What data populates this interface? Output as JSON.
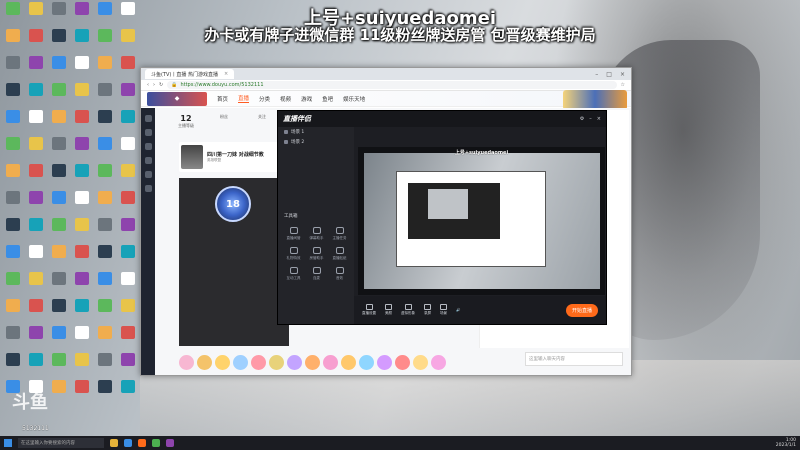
{
  "overlay": {
    "line1": "上号+suiyuedaomei",
    "line2": "办卡或有牌子进微信群 11级粉丝牌送房管  包晋级赛维护局"
  },
  "browser": {
    "tab_title": "斗鱼(TV)丨直播 热门游戏直播",
    "url": "https://www.douyu.com/5132111",
    "nav": [
      "首页",
      "直播",
      "分类",
      "视频",
      "游戏",
      "鱼吧",
      "娱乐天地"
    ],
    "active_nav": "直播",
    "stats": [
      {
        "value": "12",
        "label": "主播等级"
      },
      {
        "value": "",
        "label": "粉丝"
      },
      {
        "value": "",
        "label": "关注"
      },
      {
        "value": "",
        "label": "直播"
      }
    ],
    "anchor_title": "四川第一刀妹 对战细节教",
    "anchor_sub": "英雄联盟",
    "badge_text": "18",
    "chat_placeholder": "这里输入聊天内容"
  },
  "stream_tool": {
    "logo": "直播伴侣",
    "scenes": [
      "场景 1",
      "场景 2"
    ],
    "tools_header": "工具箱",
    "tools": [
      "直播间管",
      "弹幕助手",
      "主播任务",
      "礼物特效",
      "房管助手",
      "直播贴纸",
      "互动工具",
      "连麦",
      "音效"
    ],
    "preview_caption": "上号+suiyuedaomei",
    "bottom_buttons": [
      "直播设置",
      "美颜",
      "虚拟形象",
      "录屏",
      "场景"
    ],
    "go_live": "开始直播"
  },
  "watermark": "斗鱼",
  "watermark_id": "5132111",
  "taskbar": {
    "search_placeholder": "在这里输入你要搜索的内容",
    "time": "1:00",
    "date": "2023/1/1"
  },
  "colors": {
    "accent": "#ff5d23",
    "go_live": "#ff6a1a",
    "tool_bg": "#1d1e23"
  }
}
